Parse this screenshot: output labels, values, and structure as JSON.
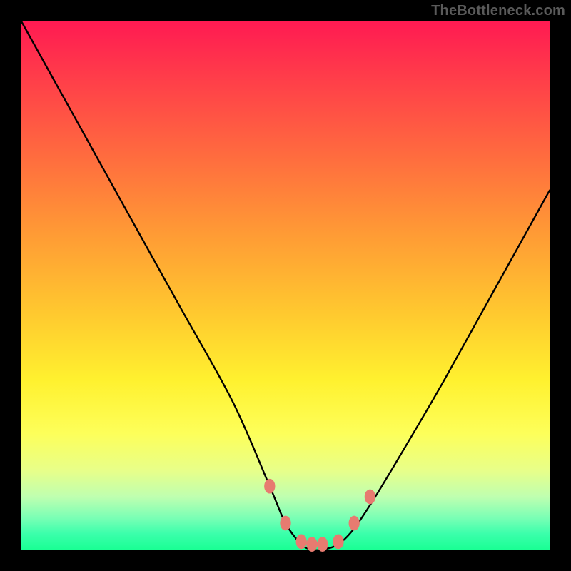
{
  "watermark": "TheBottleneck.com",
  "chart_data": {
    "type": "line",
    "title": "",
    "xlabel": "",
    "ylabel": "",
    "xlim": [
      0,
      100
    ],
    "ylim": [
      0,
      100
    ],
    "grid": false,
    "legend": false,
    "series": [
      {
        "name": "bottleneck-curve",
        "color": "#000000",
        "x": [
          0,
          10,
          20,
          30,
          40,
          47,
          50,
          53,
          55,
          57,
          60,
          63,
          67,
          73,
          80,
          90,
          100
        ],
        "y": [
          100,
          82,
          64,
          46,
          28,
          12,
          5,
          1,
          0,
          0,
          1,
          4,
          10,
          20,
          32,
          50,
          68
        ]
      }
    ],
    "markers": [
      {
        "name": "left-knee-upper",
        "x": 47,
        "y": 12
      },
      {
        "name": "left-knee-lower",
        "x": 50,
        "y": 5
      },
      {
        "name": "trough-left",
        "x": 53,
        "y": 1.5
      },
      {
        "name": "trough-mid-a",
        "x": 55,
        "y": 1
      },
      {
        "name": "trough-mid-b",
        "x": 57,
        "y": 1
      },
      {
        "name": "trough-right",
        "x": 60,
        "y": 1.5
      },
      {
        "name": "right-knee-lower",
        "x": 63,
        "y": 5
      },
      {
        "name": "right-knee-upper",
        "x": 66,
        "y": 10
      }
    ],
    "marker_color": "#e77b70",
    "marker_radius": 9
  }
}
